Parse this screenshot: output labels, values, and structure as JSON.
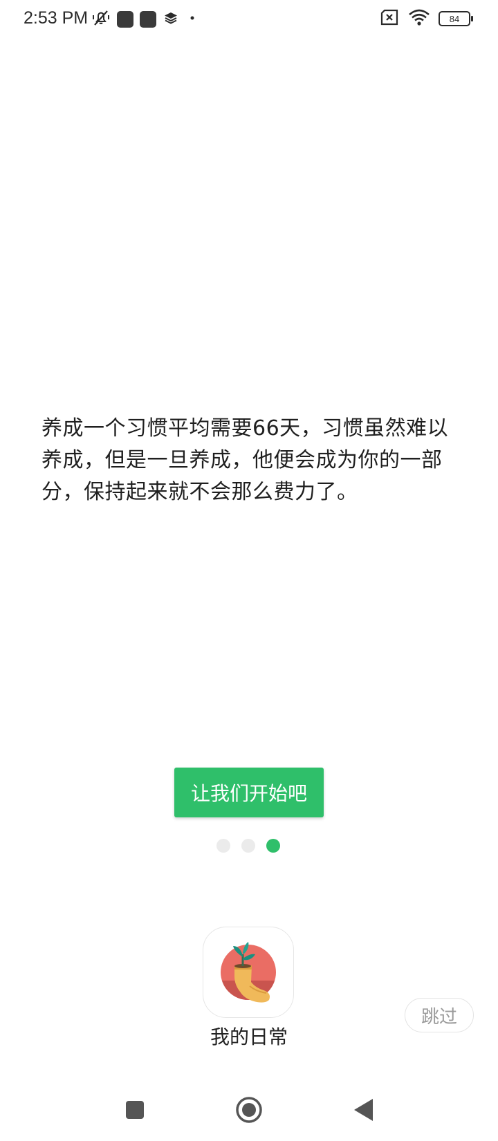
{
  "status_bar": {
    "time": "2:53 PM",
    "battery_level": "84",
    "icons": [
      "silent-icon",
      "app-notification-icon",
      "app-notification-icon",
      "layers-icon",
      "dot-icon",
      "no-sim-icon",
      "wifi-icon",
      "battery-icon"
    ]
  },
  "intro": {
    "text": "养成一个习惯平均需要66天，习惯虽然难以养成，但是一旦养成，他便会成为你的一部分，保持起来就不会那么费力了。"
  },
  "cta": {
    "label": "让我们开始吧"
  },
  "pager": {
    "total": 3,
    "active_index": 2
  },
  "app": {
    "name": "我的日常",
    "icon": "plant-in-sock-icon"
  },
  "skip": {
    "label": "跳过"
  },
  "nav": {
    "icons": [
      "recent-apps-icon",
      "home-icon",
      "back-icon"
    ]
  },
  "colors": {
    "accent": "#2fbf6a",
    "inactive_dot": "#ebebeb",
    "icon_circle": "#ea6d64"
  }
}
